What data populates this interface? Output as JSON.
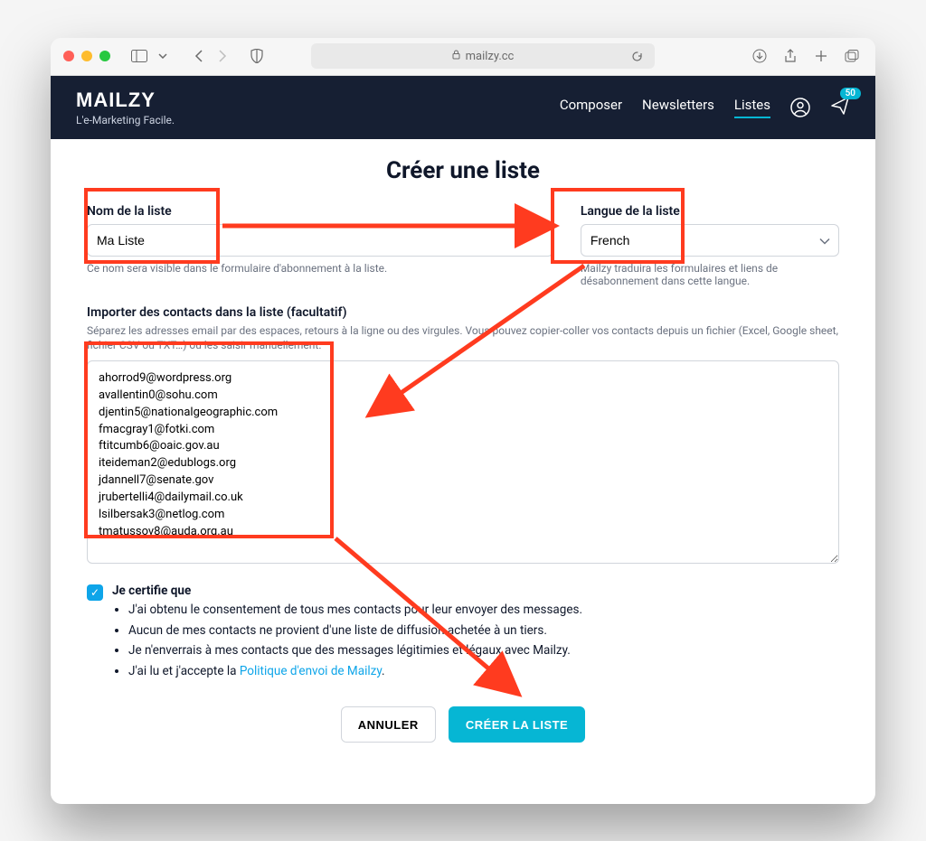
{
  "browser": {
    "url": "mailzy.cc"
  },
  "header": {
    "brand": "MAILZY",
    "tagline": "L'e-Marketing Facile.",
    "nav": {
      "compose": "Composer",
      "newsletters": "Newsletters",
      "lists": "Listes"
    },
    "badge": "50"
  },
  "page": {
    "title": "Créer une liste"
  },
  "form": {
    "name": {
      "label": "Nom de la liste",
      "value": "Ma Liste",
      "help": "Ce nom sera visible dans le formulaire d'abonnement à la liste."
    },
    "lang": {
      "label": "Langue de la liste",
      "value": "French",
      "help": "Mailzy traduira les formulaires et liens de désabonnement dans cette langue."
    },
    "import": {
      "label": "Importer des contacts dans la liste (facultatif)",
      "help": "Séparez les adresses email par des espaces, retours à la ligne ou des virgules. Vous pouvez copier-coller vos contacts depuis un fichier (Excel, Google sheet, fichier CSV ou TXT…) ou les saisir manuellement.",
      "value": "ahorrod9@wordpress.org\navallentin0@sohu.com\ndjentin5@nationalgeographic.com\nfmacgray1@fotki.com\nftitcumb6@oaic.gov.au\niteideman2@edublogs.org\njdannell7@senate.gov\njrubertelli4@dailymail.co.uk\nlsilbersak3@netlog.com\ntmatussov8@auda.org.au"
    },
    "consent": {
      "title": "Je certifie que",
      "items": [
        "J'ai obtenu le consentement de tous mes contacts pour leur envoyer des messages.",
        "Aucun de mes contacts ne provient d'une liste de diffusion achetée à un tiers.",
        "Je n'enverrais à mes contacts que des messages légitimies et légaux avec Mailzy.",
        "J'ai lu et j'accepte la "
      ],
      "policy_link": "Politique d'envoi de Mailzy"
    },
    "actions": {
      "cancel": "ANNULER",
      "submit": "CRÉER LA LISTE"
    }
  }
}
